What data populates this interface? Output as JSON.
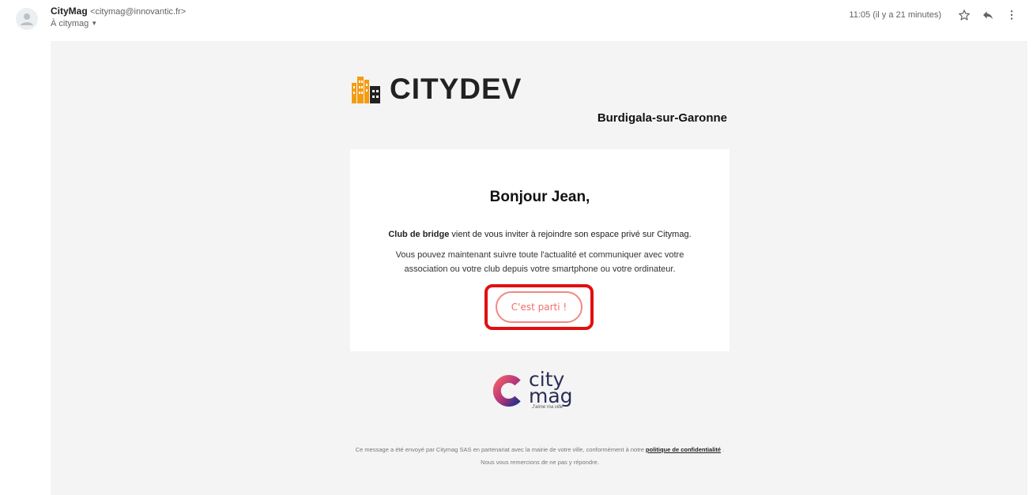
{
  "header": {
    "sender_name": "CityMag",
    "sender_email": "<citymag@innovantic.fr>",
    "recipient": "À citymag",
    "timestamp": "11:05 (il y a 21 minutes)",
    "icons": [
      "avatar-icon",
      "star-icon",
      "reply-icon",
      "more-vert-icon"
    ]
  },
  "email": {
    "brand_name": "CITYDEV",
    "city_name": "Burdigala-sur-Garonne",
    "greeting": "Bonjour Jean,",
    "invite_bold": "Club de bridge",
    "invite_rest": " vient de vous inviter à rejoindre son espace privé sur Citymag.",
    "followup": "Vous pouvez maintenant suivre toute l'actualité et communiquer avec votre association ou votre club depuis votre smartphone ou votre ordinateur.",
    "cta_label": "C'est parti !",
    "citymag_word1": "city",
    "citymag_word2": "mag",
    "citymag_tagline": "J'aime ma ville",
    "footer_text": "Ce message a été envoyé par Citymag SAS en partenariat avec la mairie de votre ville, conformément à notre ",
    "footer_link": "politique de confidentialité",
    "footer_end": " . Nous vous remercions de ne pas y répondre.",
    "colors": {
      "accent": "#ef6f6a",
      "highlight_border": "#e01010",
      "brand_orange": "#f39c12",
      "citymag_navy": "#2a2f57"
    }
  }
}
